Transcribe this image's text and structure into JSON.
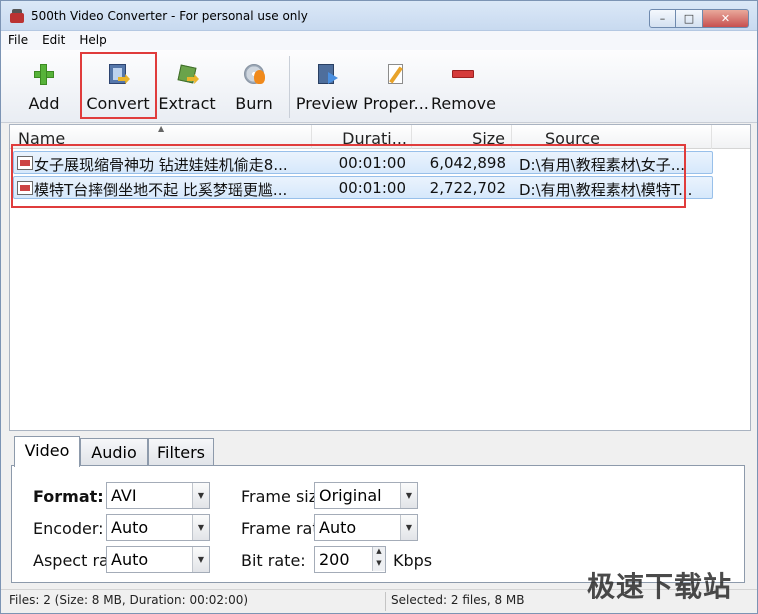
{
  "window": {
    "title": "500th Video Converter - For personal use only"
  },
  "menu": [
    {
      "label": "File"
    },
    {
      "label": "Edit"
    },
    {
      "label": "Help"
    }
  ],
  "toolbar": {
    "add": "Add",
    "convert": "Convert",
    "extract": "Extract",
    "burn": "Burn",
    "preview": "Preview",
    "properties": "Proper...",
    "remove": "Remove"
  },
  "list": {
    "columns": [
      "Name",
      "Durati...",
      "Size",
      "Source"
    ],
    "rows": [
      {
        "name": "女子展现缩骨神功 钻进娃娃机偷走8...",
        "duration": "00:01:00",
        "size": "6,042,898",
        "source": "D:\\有用\\教程素材\\女子..."
      },
      {
        "name": "模特T台摔倒坐地不起 比奚梦瑶更尴...",
        "duration": "00:01:00",
        "size": "2,722,702",
        "source": "D:\\有用\\教程素材\\模特T..."
      }
    ]
  },
  "tabs": [
    {
      "label": "Video"
    },
    {
      "label": "Audio"
    },
    {
      "label": "Filters"
    }
  ],
  "video": {
    "format_label": "Format:",
    "format_value": "AVI",
    "encoder_label": "Encoder:",
    "encoder_value": "Auto",
    "aspect_label": "Aspect ra",
    "aspect_value": "Auto",
    "framesize_label": "Frame siz",
    "framesize_value": "Original",
    "framerate_label": "Frame rat",
    "framerate_value": "Auto",
    "bitrate_label": "Bit rate:",
    "bitrate_value": "200",
    "bitrate_unit": "Kbps"
  },
  "status": {
    "files": "Files: 2 (Size: 8 MB, Duration: 00:02:00)",
    "selected": "Selected: 2 files, 8 MB"
  },
  "watermark": "极速下载站"
}
